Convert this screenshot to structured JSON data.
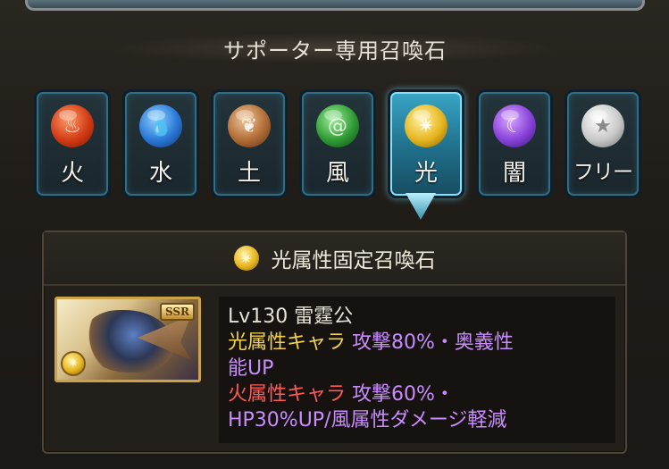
{
  "section_title": "サポーター専用召喚石",
  "element_tabs": [
    {
      "label": "火",
      "icon": "fire-orb-icon",
      "active": false
    },
    {
      "label": "水",
      "icon": "water-orb-icon",
      "active": false
    },
    {
      "label": "土",
      "icon": "earth-orb-icon",
      "active": false
    },
    {
      "label": "風",
      "icon": "wind-orb-icon",
      "active": false
    },
    {
      "label": "光",
      "icon": "light-orb-icon",
      "active": true
    },
    {
      "label": "闇",
      "icon": "dark-orb-icon",
      "active": false
    },
    {
      "label": "フリー",
      "icon": "free-star-orb-icon",
      "active": false
    }
  ],
  "panel": {
    "title": "光属性固定召喚石",
    "summon": {
      "rarity": "SSR",
      "element_icon": "light-orb-icon",
      "name_line": "Lv130 雷霆公",
      "aura_line1_target": "光属性キャラ",
      "aura_line1_effect": "攻撃80%・奥義性",
      "aura_line1_cont": "能UP",
      "aura_line2_target": "火属性キャラ",
      "aura_line2_effect": "攻撃60%・",
      "aura_line2_cont": "HP30%UP/風属性ダメージ軽減"
    }
  },
  "colors": {
    "active_tab": "#3aa6c6",
    "light_target": "#f3d34a",
    "fire_target": "#ff5a5a",
    "effect": "#c88cff"
  }
}
